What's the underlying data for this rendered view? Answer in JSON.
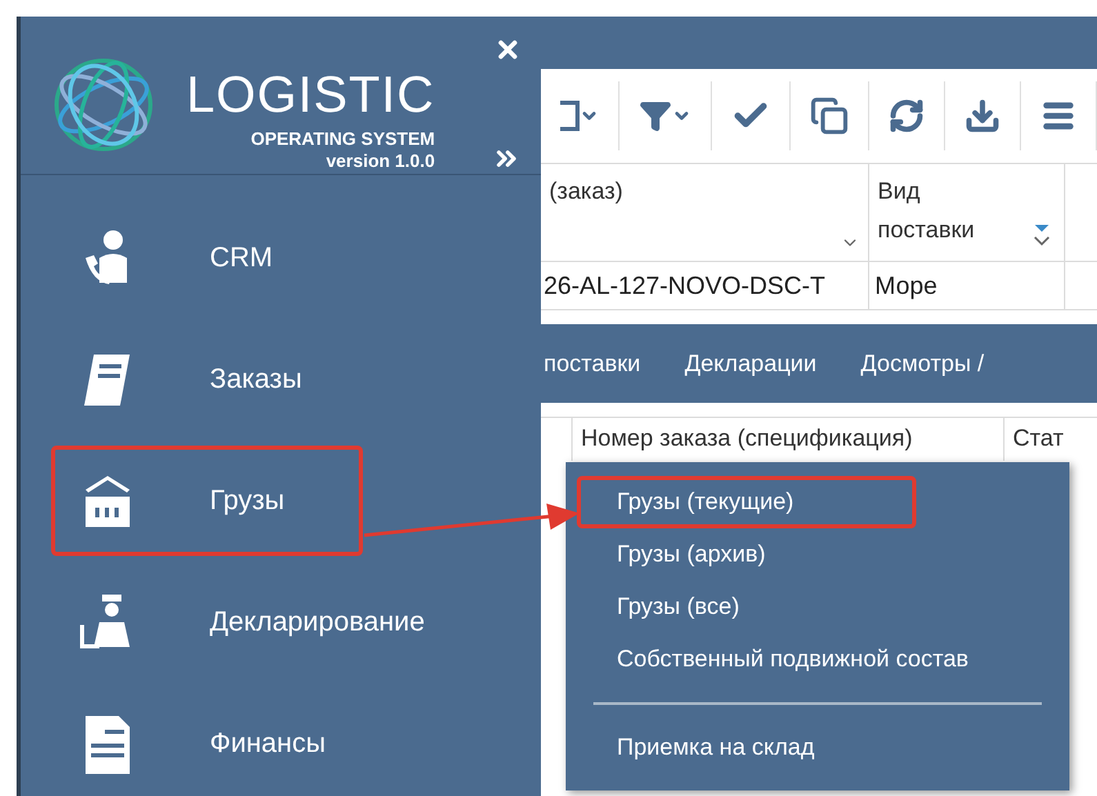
{
  "sidebar": {
    "logo": {
      "title": "LOGISTIC",
      "subtitle": "OPERATING SYSTEM",
      "version": "version 1.0.0"
    },
    "items": [
      {
        "label": "CRM",
        "kind": "crm",
        "highlighted": false
      },
      {
        "label": "Заказы",
        "kind": "orders",
        "highlighted": false
      },
      {
        "label": "Грузы",
        "kind": "cargo",
        "highlighted": true
      },
      {
        "label": "Декларирование",
        "kind": "customs",
        "highlighted": false
      },
      {
        "label": "Финансы",
        "kind": "finance",
        "highlighted": false
      }
    ]
  },
  "table": {
    "columns": [
      {
        "label": "(заказ)",
        "kind": "chevron"
      },
      {
        "label": "Вид поставки",
        "kind": "sort"
      }
    ],
    "rows": [
      [
        "26-AL-127-NOVO-DSC-T",
        "Море"
      ]
    ]
  },
  "tabs": [
    "поставки",
    "Декларации",
    "Досмотры /"
  ],
  "lower_table": {
    "columns": [
      "Номер заказа (спецификация)",
      "Стат"
    ]
  },
  "submenu": [
    {
      "kind": "item",
      "label": "Грузы (текущие)",
      "highlighted": true
    },
    {
      "kind": "item",
      "label": "Грузы (архив)",
      "highlighted": false
    },
    {
      "kind": "item",
      "label": "Грузы (все)",
      "highlighted": false
    },
    {
      "kind": "item",
      "label": "Собственный подвижной состав",
      "highlighted": false
    },
    {
      "kind": "divider"
    },
    {
      "kind": "item",
      "label": "Приемка на склад",
      "highlighted": false
    }
  ]
}
